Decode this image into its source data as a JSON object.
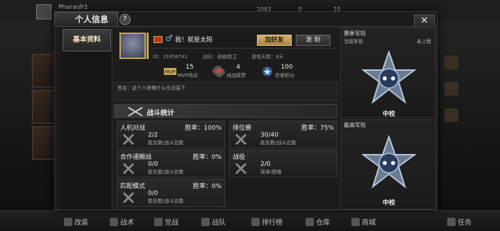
{
  "background": {
    "top_player_name": "Pharaoh1",
    "resource_1": "2063",
    "resource_2": "0",
    "resource_3": "10"
  },
  "bottom_bar": {
    "items": [
      "改装",
      "战术",
      "觉战",
      "战队",
      "排行榜",
      "仓库",
      "商城",
      "任务"
    ]
  },
  "panel": {
    "title": "个人信息",
    "help_label": "?",
    "close_label": "✕"
  },
  "sidebar": {
    "tab_label": "基本资料"
  },
  "profile": {
    "player_name": "我！就是太阳",
    "gender_symbol": "♂",
    "add_friend_label": "加好友",
    "copy_label": "复 制",
    "id_text": "ID：31956741",
    "team_text": "战队：雨痕暗卫",
    "days_text": "游戏天数：8天"
  },
  "quick_stats": [
    {
      "icon": "mvp-icon",
      "value": "15",
      "label": "MVP场次"
    },
    {
      "icon": "heart-icon",
      "value": "4",
      "label": "对战获赞"
    },
    {
      "icon": "star-icon",
      "value": "100",
      "label": "信誉积分"
    }
  ],
  "signature": "签名：这个人很懒什么也没留下",
  "battle": {
    "section_title": "战斗统计",
    "cells": [
      {
        "title": "人机对战",
        "rate": "胜率：100%",
        "value": "2/2",
        "sub": "胜负数/战斗总数"
      },
      {
        "title": "排位赛",
        "rate": "胜率：75%",
        "value": "30/40",
        "sub": "胜负数/战斗总数"
      },
      {
        "title": "合作通關战",
        "rate": "胜率：0%",
        "value": "0/0",
        "sub": "胜负数/战斗总数"
      },
      {
        "title": "战役",
        "rate": "",
        "value": "2/0",
        "sub": "简单/困难"
      },
      {
        "title": "匹配模式",
        "rate": "胜率：0%",
        "value": "0/0",
        "sub": "胜负数/战斗总数"
      }
    ]
  },
  "rank": {
    "section_title": "赛季军衔",
    "current_label": "当前军衔",
    "status_label": "未上榜",
    "current_rank": "中校",
    "best_label": "最高军衔",
    "best_rank": "中校"
  },
  "colors": {
    "accent_gold": "#c8a85a",
    "panel_bg": "#1c1c1c"
  }
}
